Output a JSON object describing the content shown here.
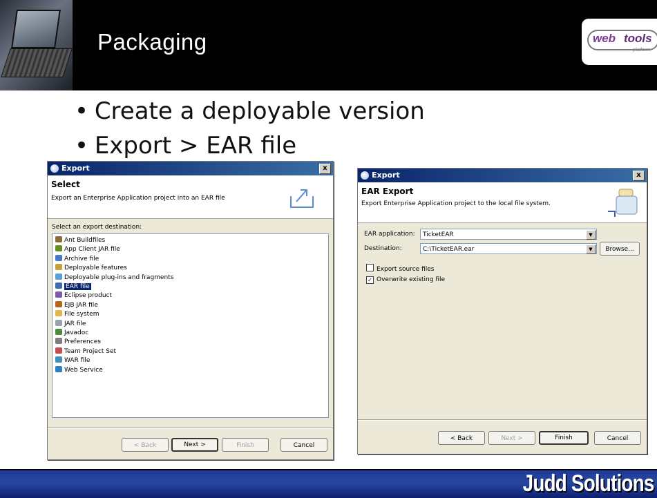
{
  "slide": {
    "title": "Packaging",
    "logo": {
      "part1": "web",
      "part2": "tools",
      "tagline": "platform"
    },
    "bullets": [
      "Create a deployable version",
      "Export > EAR file"
    ],
    "footer_brand": "Judd Solutions"
  },
  "dialog_left": {
    "title": "Export",
    "close": "x",
    "banner_title": "Select",
    "banner_desc": "Export an Enterprise Application project into an EAR file",
    "list_label": "Select an export destination:",
    "items": [
      {
        "label": "Ant Buildfiles",
        "icon": "ant-icon",
        "color": "#8a6d3b"
      },
      {
        "label": "App Client JAR file",
        "icon": "app-client-jar-icon",
        "color": "#6b8e23"
      },
      {
        "label": "Archive file",
        "icon": "archive-icon",
        "color": "#4a78c2"
      },
      {
        "label": "Deployable features",
        "icon": "feature-icon",
        "color": "#c7a23a"
      },
      {
        "label": "Deployable plug-ins and fragments",
        "icon": "plugin-icon",
        "color": "#5aa0d6"
      },
      {
        "label": "EAR file",
        "icon": "ear-icon",
        "color": "#3d6db5"
      },
      {
        "label": "Eclipse product",
        "icon": "product-icon",
        "color": "#7b5ea7"
      },
      {
        "label": "EJB JAR file",
        "icon": "ejb-icon",
        "color": "#b5651d"
      },
      {
        "label": "File system",
        "icon": "folder-icon",
        "color": "#e0b84a"
      },
      {
        "label": "JAR file",
        "icon": "jar-icon",
        "color": "#9aa3ad"
      },
      {
        "label": "Javadoc",
        "icon": "javadoc-icon",
        "color": "#4d8a3f"
      },
      {
        "label": "Preferences",
        "icon": "preferences-icon",
        "color": "#7d7d7d"
      },
      {
        "label": "Team Project Set",
        "icon": "team-icon",
        "color": "#c0504d"
      },
      {
        "label": "WAR file",
        "icon": "war-icon",
        "color": "#3f8fbf"
      },
      {
        "label": "Web Service",
        "icon": "web-service-icon",
        "color": "#2f7fbf"
      }
    ],
    "selected_index": 5,
    "buttons": {
      "back": "< Back",
      "next": "Next >",
      "finish": "Finish",
      "cancel": "Cancel"
    }
  },
  "dialog_right": {
    "title": "Export",
    "close": "x",
    "banner_title": "EAR Export",
    "banner_desc": "Export Enterprise Application project to the local file system.",
    "ear_app_label": "EAR application:",
    "ear_app_value": "TicketEAR",
    "dest_label": "Destination:",
    "dest_value": "C:\\TicketEAR.ear",
    "browse": "Browse...",
    "export_source_label": "Export source files",
    "export_source_checked": false,
    "overwrite_label": "Overwrite existing file",
    "overwrite_checked": true,
    "buttons": {
      "back": "< Back",
      "next": "Next >",
      "finish": "Finish",
      "cancel": "Cancel"
    }
  },
  "colors": {
    "title_bar": "#0a246a",
    "selection": "#0a246a",
    "footer": "#1f3a9a"
  }
}
